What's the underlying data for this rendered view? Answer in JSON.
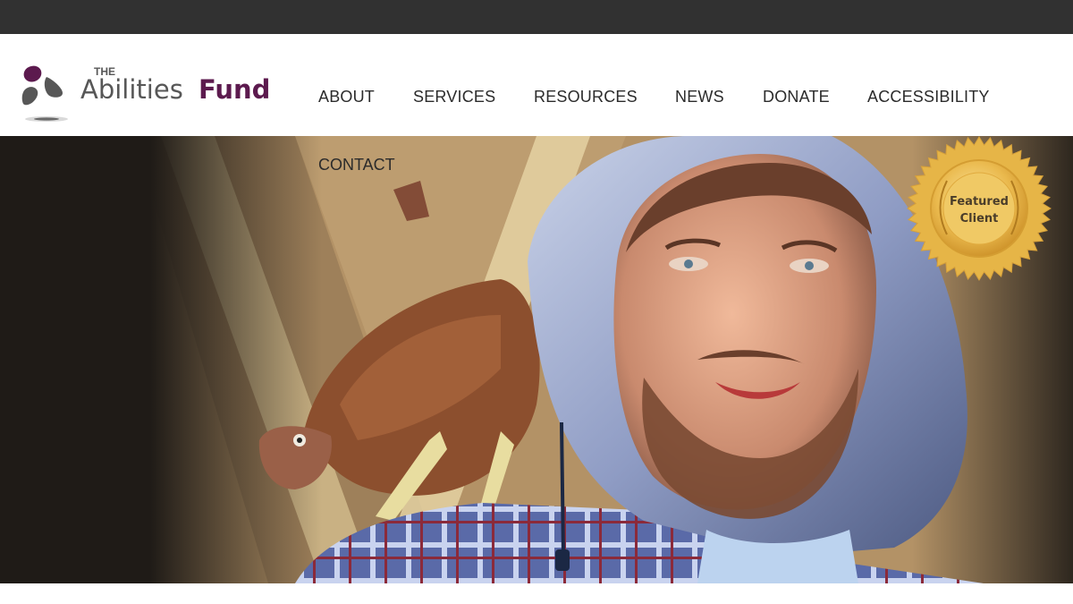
{
  "brand": {
    "prefix": "THE",
    "name_part1": "Abilities",
    "name_part2": "Fund",
    "colors": {
      "purple": "#5c1a4e",
      "gray": "#575757"
    }
  },
  "nav": {
    "items": [
      "ABOUT",
      "SERVICES",
      "RESOURCES",
      "NEWS",
      "DONATE",
      "ACCESSIBILITY"
    ],
    "contact": "CONTACT"
  },
  "hero": {
    "image": "man-in-hoodie-with-chicken-photo"
  },
  "badge": {
    "line1": "Featured",
    "line2": "Client",
    "color": "#e8b848"
  },
  "colors": {
    "topbar": "#313131",
    "nav_text": "#2b2b2b",
    "hero_bg": "#1f1b17"
  }
}
